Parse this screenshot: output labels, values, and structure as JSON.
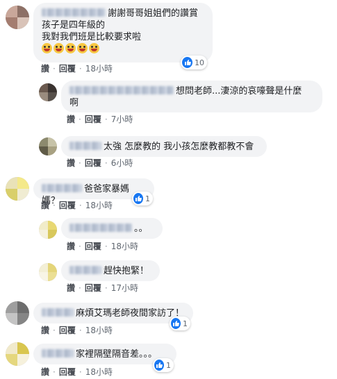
{
  "actions": {
    "like": "讚",
    "reply": "回覆",
    "dot": "·"
  },
  "comments": [
    {
      "lines": [
        "謝謝哥哥姐姐們的讚賞",
        "孩子是四年級的",
        "我對我們班是比較要求啦"
      ],
      "time": "18小時",
      "reactions": "10"
    },
    {
      "lines": [
        "想問老師...淒涼的哀嚎聲是什麼",
        "啊"
      ],
      "time": "7小時"
    },
    {
      "lines": [
        "太強 怎麼教的 我小孩怎麼教都教不會"
      ],
      "time": "6小時"
    },
    {
      "lines": [
        "爸爸家暴媽媽？"
      ],
      "time": "18小時",
      "reactions": "1"
    },
    {
      "lines": [
        "。。"
      ],
      "time": "18小時"
    },
    {
      "lines": [
        "趕快抱緊！"
      ],
      "time": "17小時"
    },
    {
      "lines": [
        "麻煩艾瑪老師夜間家訪了！"
      ],
      "time": "18小時",
      "reactions": "1"
    },
    {
      "lines": [
        "家裡隔壁隔音差。。。"
      ],
      "time": "18小時",
      "reactions": "1"
    }
  ],
  "emoji_row": [
    "grinning-squinting-face",
    "grinning-squinting-face",
    "grinning-squinting-face",
    "grinning-squinting-face",
    "grinning-squinting-face"
  ],
  "colors": {
    "like_blue": "#1877f2",
    "bubble_bg": "#f2f3f5",
    "meta_text": "#606770"
  }
}
